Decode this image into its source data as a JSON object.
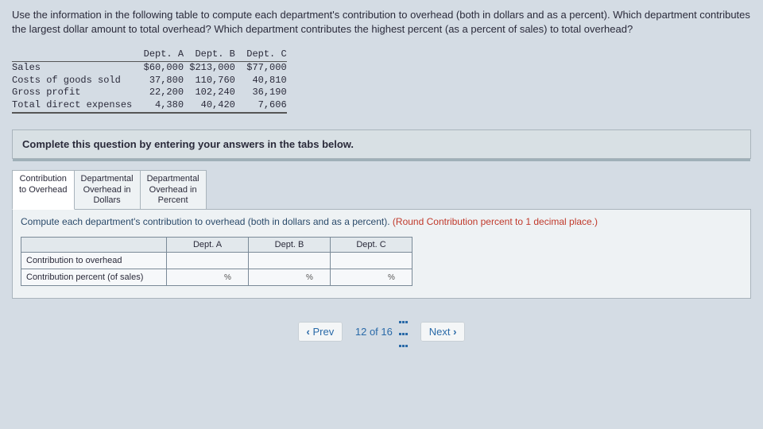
{
  "question": "Use the information in the following table to compute each department's contribution to overhead (both in dollars and as a percent). Which department contributes the largest dollar amount to total overhead? Which department contributes the highest percent (as a percent of sales) to total overhead?",
  "dataTable": {
    "headers": [
      "",
      "Dept. A",
      "Dept. B",
      "Dept. C"
    ],
    "rows": [
      [
        "Sales",
        "$60,000",
        "$213,000",
        "$77,000"
      ],
      [
        "Costs of goods sold",
        "37,800",
        "110,760",
        "40,810"
      ],
      [
        "Gross profit",
        "22,200",
        "102,240",
        "36,190"
      ],
      [
        "Total direct expenses",
        "4,380",
        "40,420",
        "7,606"
      ]
    ]
  },
  "instructionBar": "Complete this question by entering your answers in the tabs below.",
  "tabs": [
    {
      "l1": "Contribution",
      "l2": "to Overhead"
    },
    {
      "l1": "Departmental",
      "l2": "Overhead in",
      "l3": "Dollars"
    },
    {
      "l1": "Departmental",
      "l2": "Overhead in",
      "l3": "Percent"
    }
  ],
  "subInstruction": {
    "main": "Compute each department's contribution to overhead (both in dollars and as a percent). ",
    "red": "(Round Contribution percent to 1 decimal place.)"
  },
  "answerTable": {
    "cols": [
      "Dept. A",
      "Dept. B",
      "Dept. C"
    ],
    "rows": [
      "Contribution to overhead",
      "Contribution percent (of sales)"
    ],
    "pctSymbol": "%"
  },
  "nav": {
    "prev": "Prev",
    "pos": "12",
    "of": "of",
    "total": "16",
    "next": "Next"
  }
}
